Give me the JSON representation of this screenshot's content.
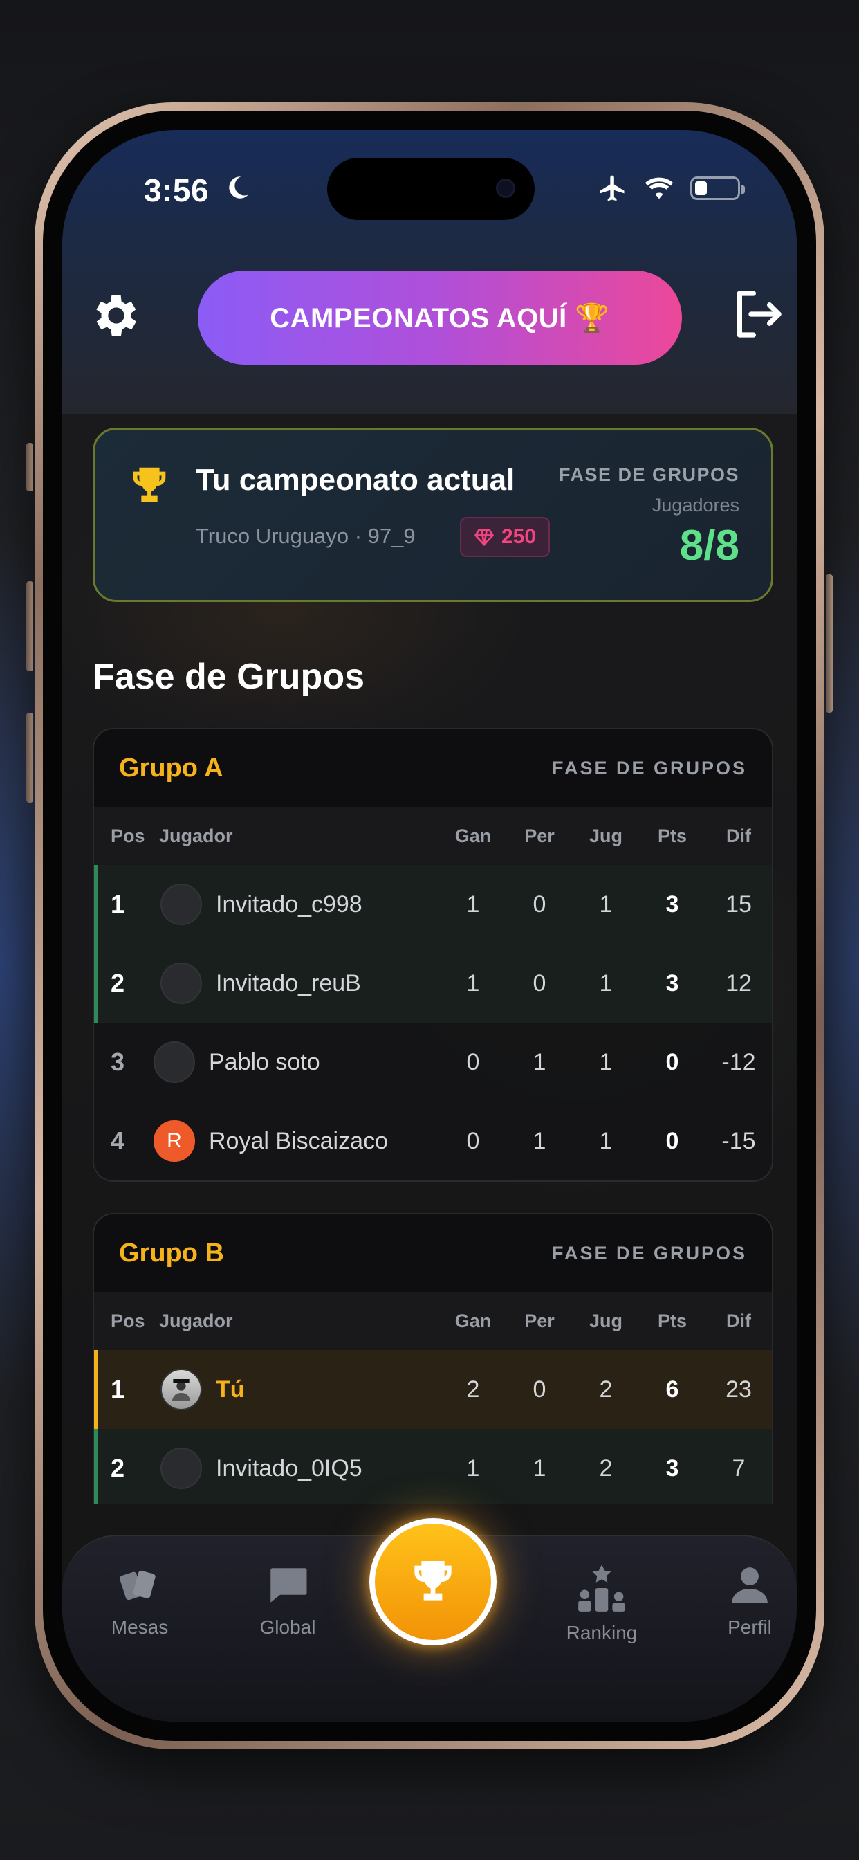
{
  "status_bar": {
    "time": "3:56"
  },
  "header": {
    "championships_button": "CAMPEONATOS AQUÍ 🏆"
  },
  "current_championship": {
    "title": "Tu campeonato actual",
    "subtitle": "Truco Uruguayo · 97_9",
    "gems": "250",
    "phase": "FASE DE GRUPOS",
    "players_label": "Jugadores",
    "players_count": "8/8"
  },
  "section_title": "Fase de Grupos",
  "columns": {
    "pos": "Pos",
    "player": "Jugador",
    "won": "Gan",
    "lost": "Per",
    "played": "Jug",
    "points": "Pts",
    "diff": "Dif"
  },
  "groups": [
    {
      "name": "Grupo A",
      "phase": "FASE DE GRUPOS",
      "rows": [
        {
          "pos": "1",
          "player": "Invitado_c998",
          "won": "1",
          "lost": "0",
          "played": "1",
          "points": "3",
          "diff": "15"
        },
        {
          "pos": "2",
          "player": "Invitado_reuB",
          "won": "1",
          "lost": "0",
          "played": "1",
          "points": "3",
          "diff": "12"
        },
        {
          "pos": "3",
          "player": "Pablo soto",
          "won": "0",
          "lost": "1",
          "played": "1",
          "points": "0",
          "diff": "-12"
        },
        {
          "pos": "4",
          "player": "Royal Biscaizaco",
          "avatar_letter": "R",
          "won": "0",
          "lost": "1",
          "played": "1",
          "points": "0",
          "diff": "-15"
        }
      ]
    },
    {
      "name": "Grupo B",
      "phase": "FASE DE GRUPOS",
      "rows": [
        {
          "pos": "1",
          "player": "Tú",
          "won": "2",
          "lost": "0",
          "played": "2",
          "points": "6",
          "diff": "23"
        },
        {
          "pos": "2",
          "player": "Invitado_0IQ5",
          "won": "1",
          "lost": "1",
          "played": "2",
          "points": "3",
          "diff": "7"
        }
      ]
    }
  ],
  "nav": {
    "mesas": "Mesas",
    "global": "Global",
    "ranking": "Ranking",
    "perfil": "Perfil"
  },
  "colors": {
    "accent_gold": "#f6b21b",
    "accent_green": "#5ee08a",
    "gem_pink": "#f2457f",
    "button_gradient_start": "#8b5cf6",
    "button_gradient_end": "#ec4899"
  },
  "icons": [
    "gear-icon",
    "logout-icon",
    "trophy-icon",
    "gem-icon",
    "cards-icon",
    "chat-icon",
    "podium-icon",
    "person-icon",
    "moon-icon",
    "airplane-icon",
    "wifi-icon",
    "battery-icon"
  ]
}
